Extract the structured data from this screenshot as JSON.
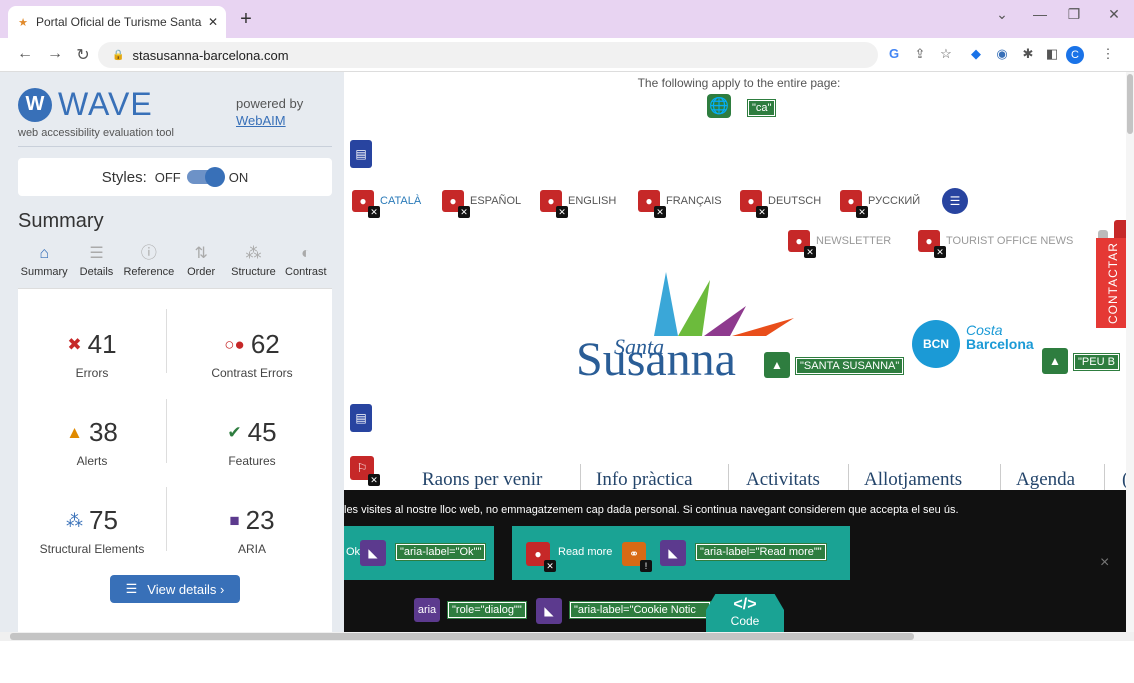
{
  "browser": {
    "tab_title": "Portal Oficial de Turisme Santa Su",
    "url": "stasusanna-barcelona.com",
    "profile_initial": "C"
  },
  "wave": {
    "logo_text": "WAVE",
    "tagline": "web accessibility evaluation tool",
    "powered_by": "powered by",
    "webaim": "WebAIM",
    "styles_label": "Styles:",
    "styles_off": "OFF",
    "styles_on": "ON",
    "summary_heading": "Summary",
    "tabs": [
      {
        "label": "Summary",
        "icon": "home-icon"
      },
      {
        "label": "Details",
        "icon": "list-icon"
      },
      {
        "label": "Reference",
        "icon": "info-icon"
      },
      {
        "label": "Order",
        "icon": "order-icon"
      },
      {
        "label": "Structure",
        "icon": "structure-icon"
      },
      {
        "label": "Contrast",
        "icon": "contrast-icon"
      }
    ],
    "stats": {
      "errors": {
        "value": "41",
        "label": "Errors"
      },
      "contrast": {
        "value": "62",
        "label": "Contrast Errors"
      },
      "alerts": {
        "value": "38",
        "label": "Alerts"
      },
      "features": {
        "value": "45",
        "label": "Features"
      },
      "structural": {
        "value": "75",
        "label": "Structural Elements"
      },
      "aria": {
        "value": "23",
        "label": "ARIA"
      }
    },
    "view_details": "View details ›",
    "colors": {
      "accent": "#3870b8",
      "error": "#c62828",
      "alert": "#e08a00",
      "feature": "#2e7d3f",
      "aria": "#5c3a8e"
    }
  },
  "page": {
    "applies_text": "The following apply to the entire page:",
    "lang_label": "\"ca\"",
    "languages": [
      "CATALÀ",
      "ESPAÑOL",
      "ENGLISH",
      "FRANÇAIS",
      "DEUTSCH",
      "РУССКИЙ"
    ],
    "secondary_links": [
      "NEWSLETTER",
      "TOURIST OFFICE NEWS"
    ],
    "logo_alt": "\"SANTA SUSANNA\"",
    "logo_alt2": "\"PEU B",
    "santa": "Santa",
    "susanna": "Susanna",
    "bcn": "BCN",
    "costa": "Costa",
    "barcelona": "Barcelona",
    "contact": "CONTACTAR",
    "menu": [
      "Raons per venir",
      "Info pràctica",
      "Activitats",
      "Allotjaments",
      "Agenda",
      "("
    ],
    "cookie_text": "les visites al nostre lloc web, no emmagatzemem cap dada personal. Si continua navegant considerem que accepta el seu ús.",
    "ok_label": "Ok",
    "ok_aria": "\"aria-label=\"Ok\"\"",
    "read_more": "Read more",
    "read_more_aria": "\"aria-label=\"Read more\"\"",
    "aria_text": "aria",
    "role_dialog": "\"role=\"dialog\"\"",
    "cookie_aria": "\"aria-label=\"Cookie Notic",
    "code_label": "Code",
    "code_glyph": "</>",
    "close": "×"
  }
}
